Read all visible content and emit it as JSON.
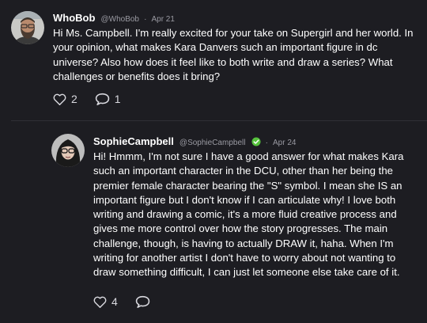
{
  "posts": [
    {
      "author": "WhoBob",
      "handle": "@WhoBob",
      "separator": "·",
      "date": "Apr 21",
      "text": "Hi Ms. Campbell. I'm really excited for your take on Supergirl and her world. In your opinion, what makes Kara Danvers such an important figure in dc universe? Also how does it feel like to both write and draw a series? What challenges or benefits does it bring?",
      "likes": "2",
      "replies": "1",
      "avatar_icon": "bearded-man-avatar"
    },
    {
      "author": "SophieCampbell",
      "handle": "@SophieCampbell",
      "separator": "·",
      "date": "Apr 24",
      "verified": true,
      "text": "Hi! Hmmm, I'm not sure I have a good answer for what makes Kara such an important character in the DCU, other than her being the premier female character bearing the \"S\" symbol. I mean she IS an important figure but I don't know if I can articulate why! I love both writing and drawing a comic, it's a more fluid creative process and gives me more control over how the story progresses. The main challenge, though, is having to actually DRAW it, haha. When I'm writing for another artist I don't have to worry about not wanting to draw something difficult, I can just let someone else take care of it.",
      "likes": "4",
      "replies": "",
      "avatar_icon": "woman-glasses-avatar"
    }
  ],
  "colors": {
    "background": "#1d1d22",
    "verified": "#56c23c",
    "muted": "#9a9aa2"
  }
}
